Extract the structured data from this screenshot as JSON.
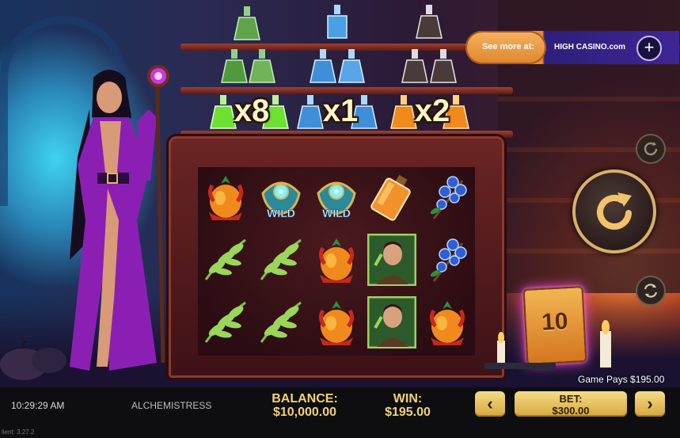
{
  "game": {
    "title": "ALCHEMISTRESS"
  },
  "multipliers": [
    "x8",
    "x1",
    "x2"
  ],
  "promo": {
    "label": "See more at:",
    "brand": "HIGH CASINO.com",
    "plus_label": "+"
  },
  "reels": [
    [
      "flower",
      "leaf",
      "leaf"
    ],
    [
      "wild",
      "leaf",
      "leaf"
    ],
    [
      "wild",
      "flower",
      "flower"
    ],
    [
      "potion",
      "alchemist",
      "alchemist"
    ],
    [
      "berries",
      "berries",
      "flower"
    ]
  ],
  "wild_label": "WILD",
  "free_spins_card": {
    "value": "10"
  },
  "game_pays": "Game Pays $195.00",
  "status_bar": {
    "time": "10:29:29 AM",
    "balance_label": "BALANCE:",
    "balance_value": "$10,000.00",
    "win_label": "WIN:",
    "win_value": "$195.00",
    "bet_label": "BET:",
    "bet_value": "$300.00",
    "bet_decrease": "‹",
    "bet_increase": "›",
    "version": "lient: 3.27.2"
  },
  "colors": {
    "gold_text": "#f2d27a",
    "accent_orange": "#e98a2d",
    "promo_purple": "#3f2596"
  },
  "icons": {
    "spin": "spin-arrow-icon",
    "autoplay": "autoplay-icon",
    "turbo": "turbo-icon",
    "plus": "plus-icon"
  }
}
